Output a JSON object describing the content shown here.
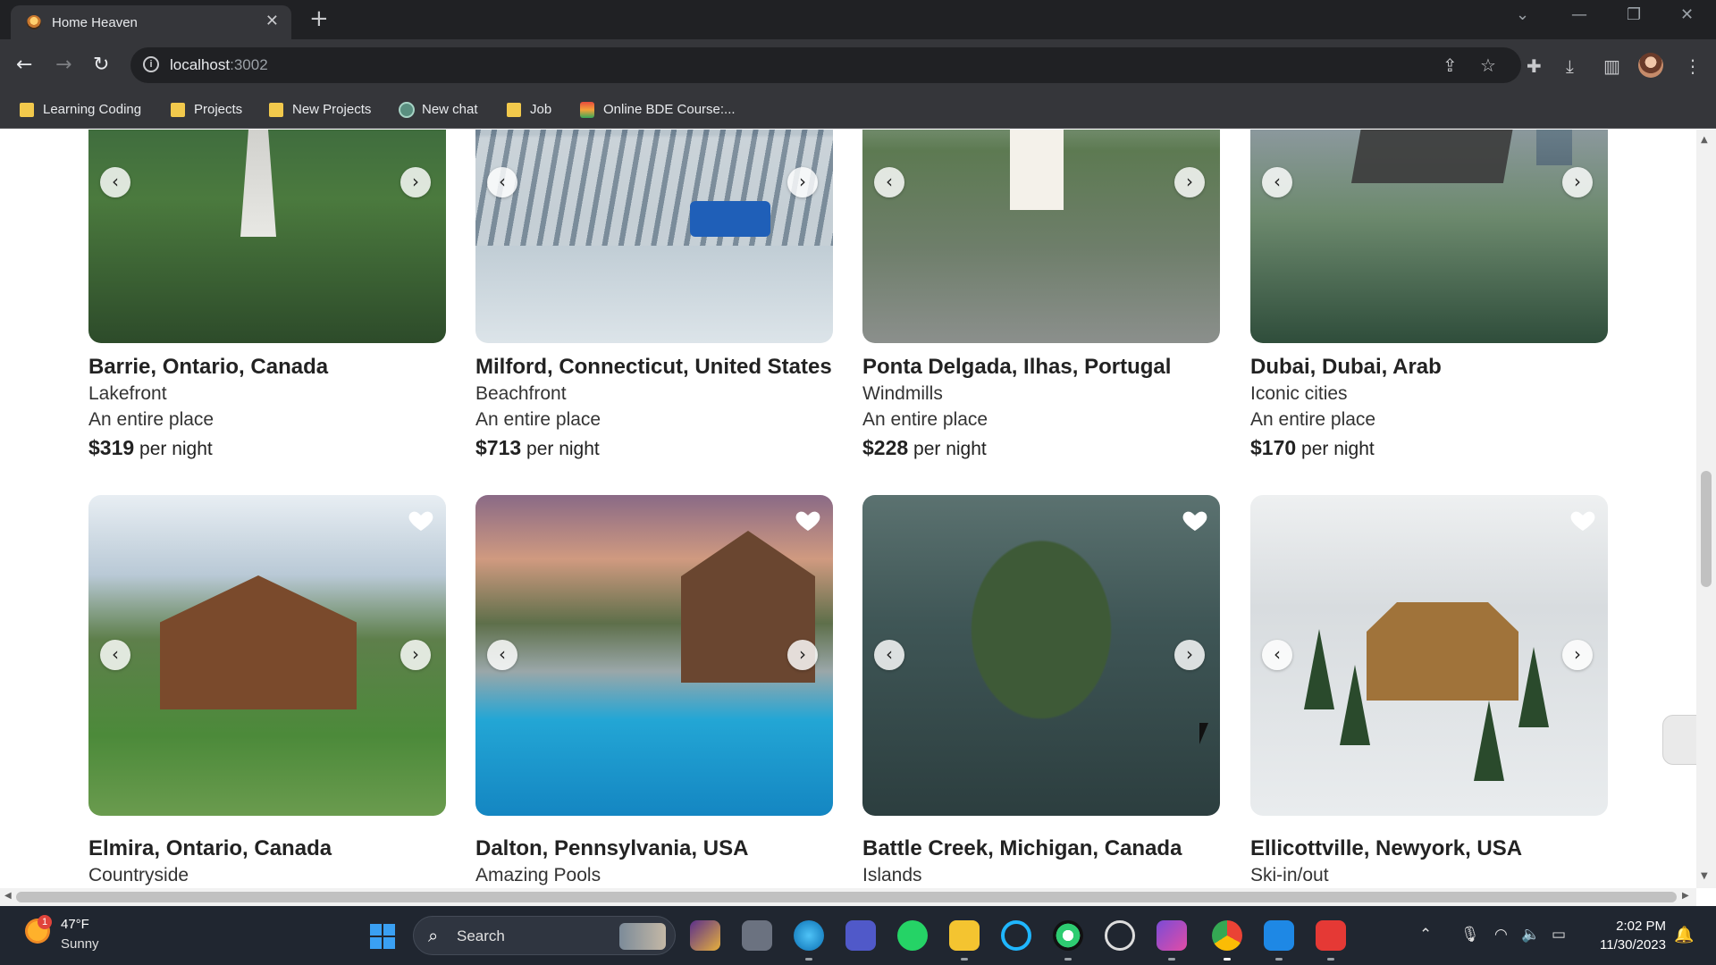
{
  "browser": {
    "tab_title": "Home Heaven",
    "url_host": "localhost",
    "url_port": ":3002",
    "bookmarks": [
      "Learning Coding",
      "Projects",
      "New Projects",
      "New chat",
      "Job",
      "Online BDE Course:..."
    ]
  },
  "listings": [
    {
      "location": "Barrie, Ontario, Canada",
      "category": "Lakefront",
      "type": "An entire place",
      "price": "$319",
      "price_suffix": "per night",
      "favorited_icon": "heart-icon"
    },
    {
      "location": "Milford, Connecticut, United States",
      "category": "Beachfront",
      "type": "An entire place",
      "price": "$713",
      "price_suffix": "per night",
      "favorited_icon": "heart-icon"
    },
    {
      "location": "Ponta Delgada, Ilhas, Portugal",
      "category": "Windmills",
      "type": "An entire place",
      "price": "$228",
      "price_suffix": "per night",
      "favorited_icon": "heart-icon"
    },
    {
      "location": "Dubai, Dubai, Arab",
      "category": "Iconic cities",
      "type": "An entire place",
      "price": "$170",
      "price_suffix": "per night",
      "favorited_icon": "heart-icon"
    },
    {
      "location": "Elmira, Ontario, Canada",
      "category": "Countryside"
    },
    {
      "location": "Dalton, Pennsylvania, USA",
      "category": "Amazing Pools"
    },
    {
      "location": "Battle Creek, Michigan, Canada",
      "category": "Islands"
    },
    {
      "location": "Ellicottville, Newyork, USA",
      "category": "Ski-in/out"
    }
  ],
  "taskbar": {
    "weather_temp": "47°F",
    "weather_desc": "Sunny",
    "weather_badge": "1",
    "search_label": "Search",
    "time": "2:02 PM",
    "date": "11/30/2023"
  }
}
